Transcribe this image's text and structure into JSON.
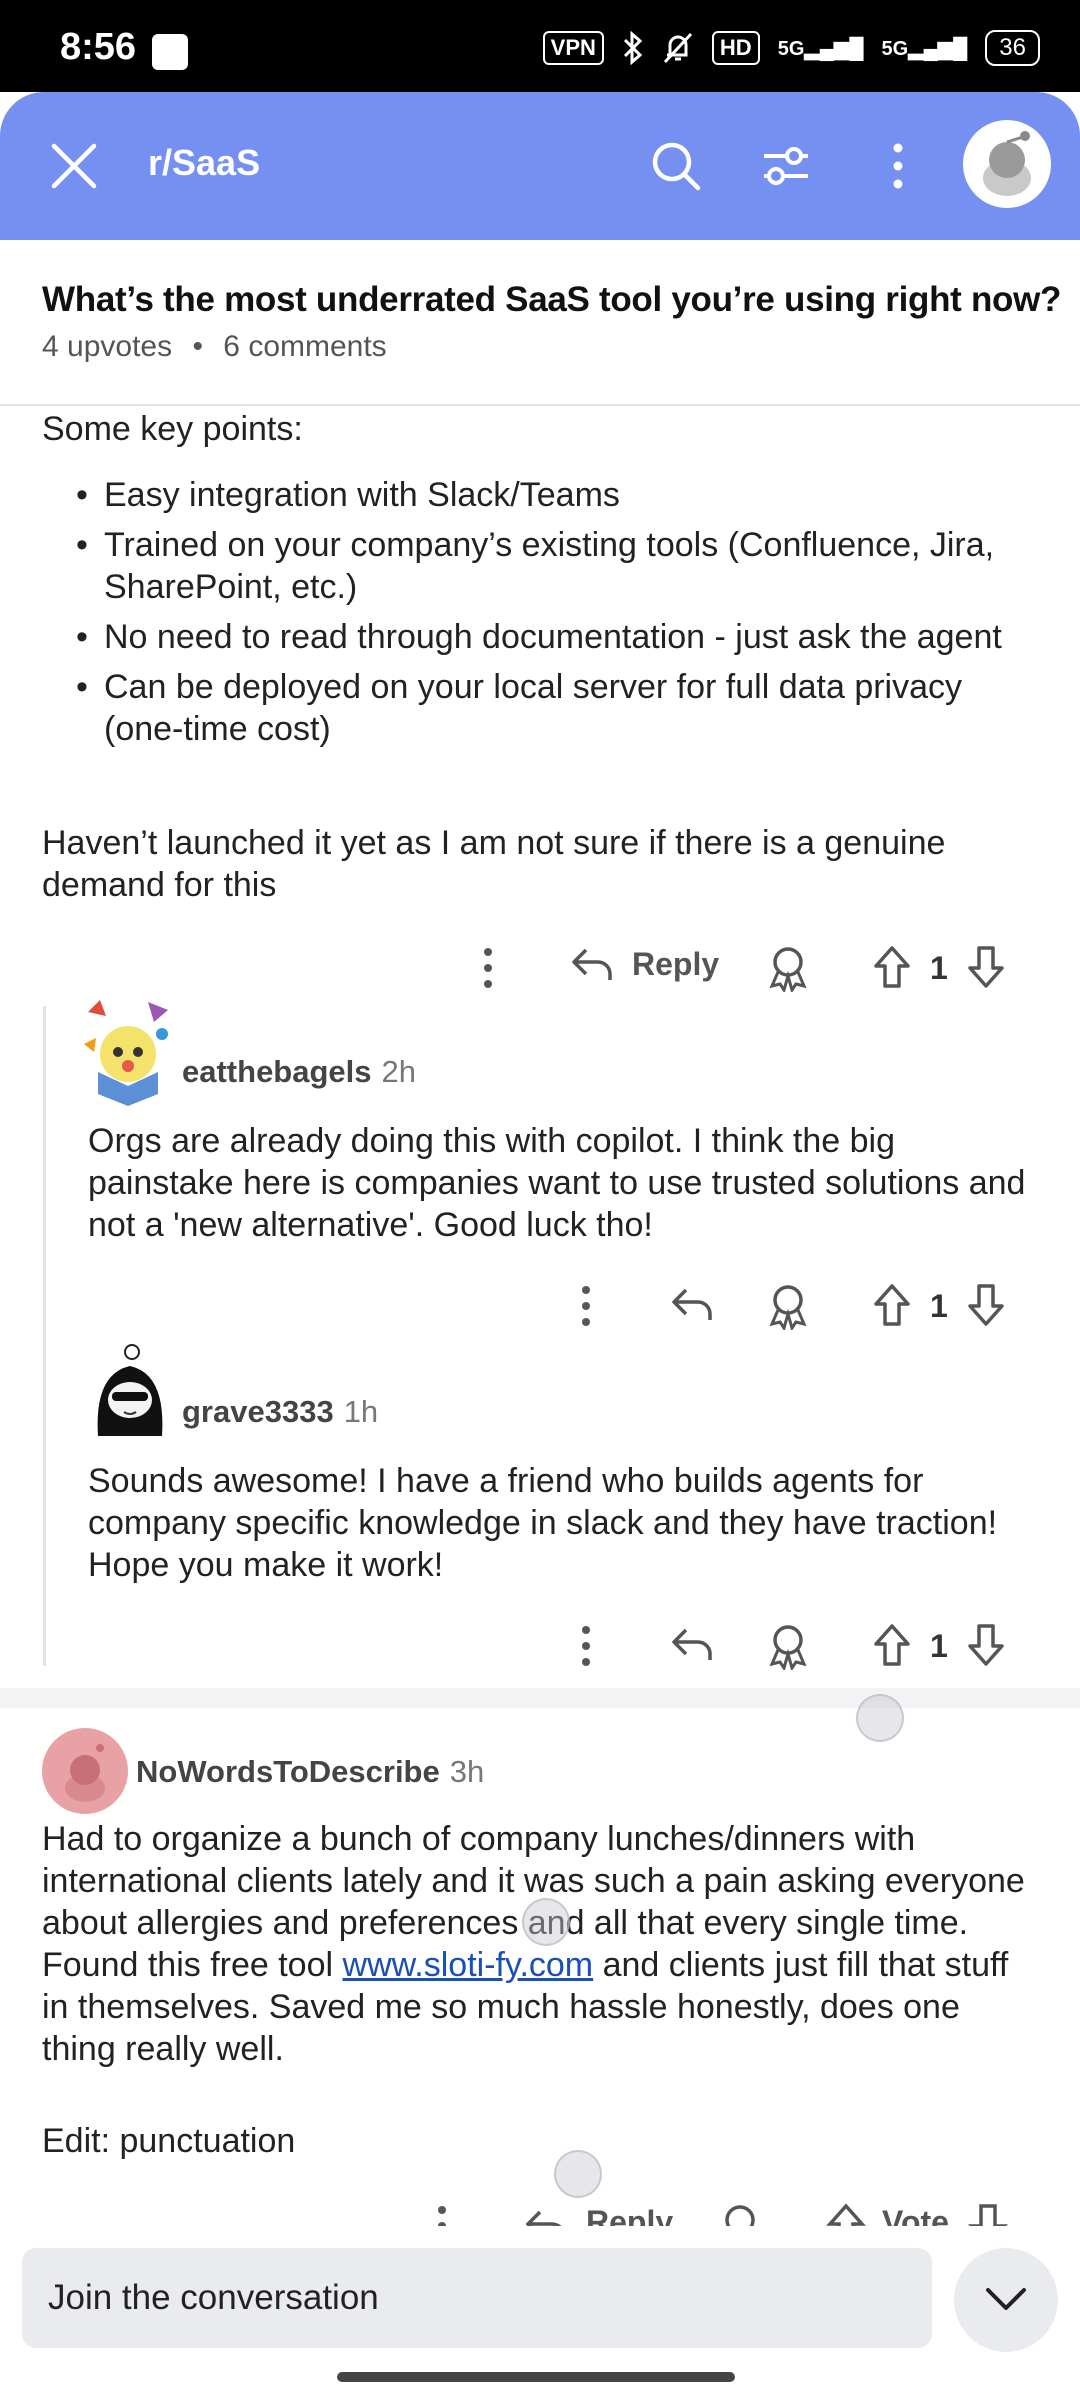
{
  "status_bar": {
    "time": "8:56",
    "vpn": "VPN",
    "hd": "HD",
    "net1": "5G",
    "net2": "5G",
    "battery": "36"
  },
  "header": {
    "subreddit": "r/SaaS"
  },
  "post": {
    "title": "What’s the most underrated SaaS tool you’re using right now?",
    "upvotes": "4 upvotes",
    "comments": "6 comments"
  },
  "comment1": {
    "intro": "Some key points:",
    "bullets": [
      "Easy integration with Slack/Teams",
      "Trained on your company’s existing tools (Confluence, Jira, SharePoint, etc.)",
      "No need to read through documentation - just ask the agent",
      "Can be deployed on your local server for full data privacy (one-time cost)"
    ],
    "closing": "Haven’t launched it yet as I am not sure if there is a genuine demand for this",
    "reply_label": "Reply",
    "votes": "1"
  },
  "reply1": {
    "username": "eatthebagels",
    "time": "2h",
    "text": "Orgs are already doing this with copilot. I think the big painstake here is companies want to use trusted solutions and not a 'new alternative'. Good luck tho!",
    "votes": "1"
  },
  "reply2": {
    "username": "grave3333",
    "time": "1h",
    "text": "Sounds awesome! I have a friend who builds agents for company specific knowledge in slack and they have traction! Hope you make it work!",
    "votes": "1"
  },
  "comment2": {
    "username": "NoWordsToDescribe",
    "time": "3h",
    "text_before": "Had to organize a bunch of company lunches/dinners with international clients lately and it was such a pain asking everyone about allergies and preferences and all that every single time. Found this free tool ",
    "link": "www.sloti-fy.com",
    "text_after": " and clients just fill that stuff in themselves. Saved me so much hassle honestly, does one thing really well.",
    "edit": "Edit: punctuation",
    "reply_label": "Reply",
    "vote_label": "Vote"
  },
  "composer": {
    "placeholder": "Join the conversation"
  },
  "colors": {
    "header": "#7590f1",
    "link": "#1a4fb8"
  }
}
